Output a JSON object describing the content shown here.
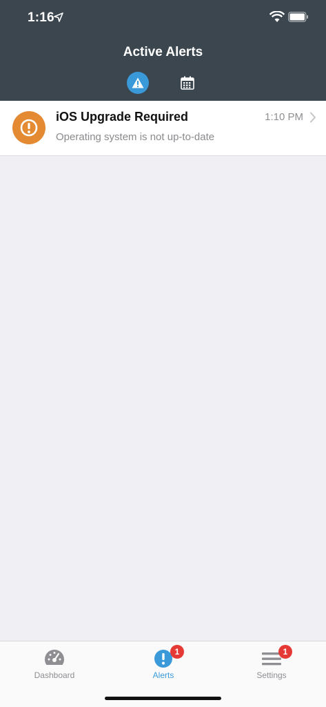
{
  "status_bar": {
    "time": "1:16"
  },
  "header": {
    "title": "Active Alerts"
  },
  "alerts": [
    {
      "title": "iOS Upgrade Required",
      "subtitle": "Operating system is not up-to-date",
      "time": "1:10 PM"
    }
  ],
  "tab_bar": {
    "items": [
      {
        "label": "Dashboard",
        "icon": "dashboard-gauge-icon",
        "badge": ""
      },
      {
        "label": "Alerts",
        "icon": "alert-exclamation-icon",
        "badge": "1"
      },
      {
        "label": "Settings",
        "icon": "settings-menu-icon",
        "badge": "1"
      }
    ]
  },
  "colors": {
    "header_bg": "#3b464f",
    "accent": "#3a9ad9",
    "alert_orange": "#e38a33",
    "badge_red": "#e53935"
  }
}
